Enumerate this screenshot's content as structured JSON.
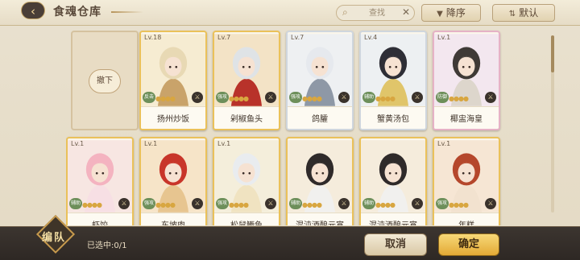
{
  "header": {
    "title": "食魂仓库",
    "search_placeholder": "查找",
    "sort_desc_label": "降序",
    "sort_default_label": "默认"
  },
  "grid": {
    "unequip_label": "撤下",
    "cards": [
      {
        "level": "Lv.18",
        "name": "扬州炒饭",
        "role": "反击",
        "frame": "gold",
        "stars": "●●●●",
        "bg": "#f6ecd2",
        "hair": "#e8d9b4",
        "cloth": "#c9a36a"
      },
      {
        "level": "Lv.7",
        "name": "剁椒鱼头",
        "role": "强攻",
        "frame": "gold",
        "stars": "●●●●",
        "bg": "#f3e3c6",
        "hair": "#dfe3e6",
        "cloth": "#b8322a"
      },
      {
        "level": "Lv.7",
        "name": "鸽臛",
        "role": "强攻",
        "frame": "silver",
        "stars": "●●●●",
        "bg": "#eef0f2",
        "hair": "#e6e9ee",
        "cloth": "#8e98a6"
      },
      {
        "level": "Lv.4",
        "name": "蟹黄汤包",
        "role": "辅助",
        "frame": "silver",
        "stars": "●●●●",
        "bg": "#edf0f2",
        "hair": "#2e2e36",
        "cloth": "#e0c56a"
      },
      {
        "level": "Lv.1",
        "name": "椰盅海皇",
        "role": "防御",
        "frame": "pink",
        "stars": "●●●●",
        "bg": "#f3e7ef",
        "hair": "#3f3a36",
        "cloth": "#ddd6cc"
      },
      {
        "level": "Lv.1",
        "name": "虾饺",
        "role": "辅助",
        "frame": "gold",
        "stars": "●●●●",
        "bg": "#f7e6e2",
        "hair": "#f4b3c0",
        "cloth": "#f7dfe4"
      },
      {
        "level": "Lv.1",
        "name": "东坡肉",
        "role": "强攻",
        "frame": "gold",
        "stars": "●●●●",
        "bg": "#f6e4c8",
        "hair": "#c8352a",
        "cloth": "#e7c590"
      },
      {
        "level": "Lv.1",
        "name": "松鼠鳜鱼",
        "role": "强攻",
        "frame": "gold",
        "stars": "●●●●",
        "bg": "#f4eedb",
        "hair": "#e9ecef",
        "cloth": "#f0e3c1"
      },
      {
        "level": "",
        "name": "混沌酒酿元宵",
        "role": "辅助",
        "frame": "gold",
        "stars": "●●●●",
        "bg": "#f5ecdc",
        "hair": "#2f2a2a",
        "cloth": "#f1f0ee"
      },
      {
        "level": "",
        "name": "混沌酒酿元宵",
        "role": "辅助",
        "frame": "gold",
        "stars": "●●●●",
        "bg": "#f5ecdc",
        "hair": "#2f2a2a",
        "cloth": "#f1f0ee"
      },
      {
        "level": "Lv.1",
        "name": "年糕",
        "role": "强攻",
        "frame": "gold",
        "stars": "●●●●",
        "bg": "#f6e6d4",
        "hair": "#b5472c",
        "cloth": "#f2e2cf"
      }
    ]
  },
  "footer": {
    "team_label": "编队",
    "selected_text": "已选中:0/1",
    "cancel_label": "取消",
    "confirm_label": "确定"
  }
}
